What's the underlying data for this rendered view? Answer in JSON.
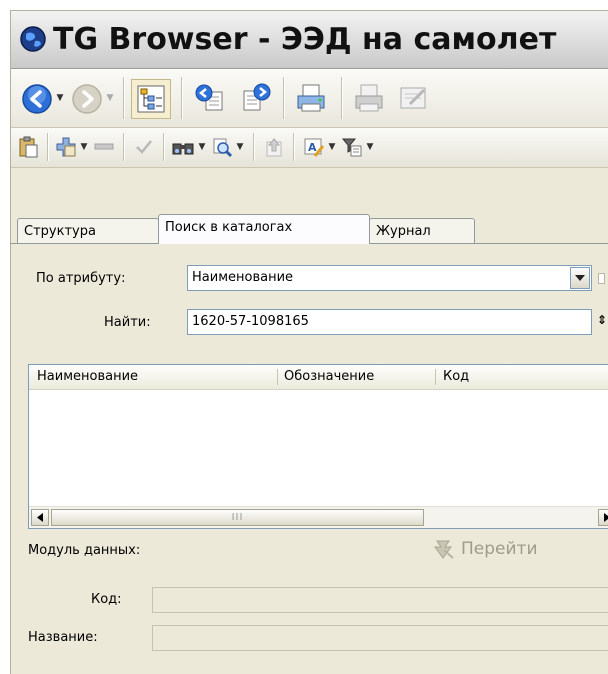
{
  "window": {
    "title": "TG Browser - ЭЭД на самолет"
  },
  "tabs": [
    {
      "label": "Структура",
      "active": false
    },
    {
      "label": "Поиск в каталогах",
      "active": true
    },
    {
      "label": "Журнал",
      "active": false
    }
  ],
  "search": {
    "attribute_label": "По атрибуту:",
    "attribute_value": "Наименование",
    "find_label": "Найти:",
    "find_value": "1620-57-1098165"
  },
  "results": {
    "columns": [
      "Наименование",
      "Обозначение",
      "Код"
    ],
    "rows": [],
    "scroll_grip": "III"
  },
  "details": {
    "module_label": "Модуль данных:",
    "goto_label": "Перейти",
    "code_label": "Код:",
    "code_value": "",
    "name_label": "Название:",
    "name_value": ""
  },
  "icons": {
    "title": "globe-icon",
    "toolbar1": [
      "back-icon",
      "forward-icon",
      "tree-view-icon",
      "copy-icon",
      "paste-link-icon",
      "print-icon",
      "print-preview-icon",
      "edit-doc-icon"
    ],
    "toolbar2": [
      "clipboard-icon",
      "add-icon",
      "remove-icon",
      "check-icon",
      "find-icon",
      "search-zoom-icon",
      "up-icon",
      "rename-icon",
      "filter-icon"
    ]
  },
  "colors": {
    "accent": "#1c5fc7",
    "panel": "#ece9d8",
    "border": "#7f9db9"
  }
}
